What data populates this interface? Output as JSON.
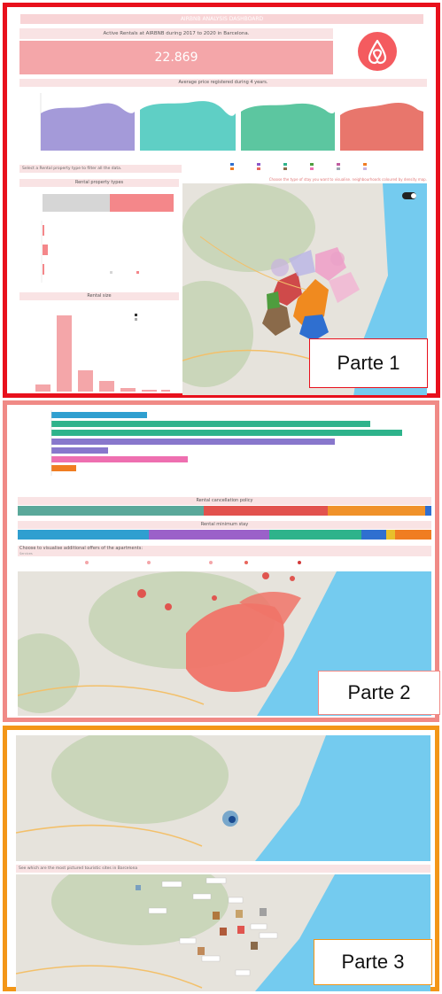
{
  "dashboard": {
    "title": "AIRBNB ANALYSIS DASHBOARD",
    "kpi_label": "Active Rentals at AIRBNB during 2017 to 2020 in Barcelona.",
    "kpi_value": "22.869",
    "avg_price_title": "Average price registered during 4 years.",
    "filter_hint": "Select a Rental property type to filter all the data.",
    "rental_types_title": "Rental property types",
    "rental_size_title": "Rental size",
    "map_hint": "Choose the type of stay you want to visualise. neighbourhoods coloured by density map.",
    "part_labels": [
      "Parte 1",
      "Parte 2",
      "Parte 3"
    ]
  },
  "part2": {
    "cancellation_title": "Rental cancellation policy",
    "min_stay_title": "Rental minimum stay",
    "offers_hint": "Choose to visualise additional offers of the apartments:",
    "offers_sub": "Services"
  },
  "part3": {
    "sights_hint": "See which are the most pictured touristic sites in Barcelona"
  },
  "colors": {
    "part1_border": "#e8101c",
    "part2_border": "#f08a86",
    "part3_border": "#f39617",
    "airbnb": "#f45b5f",
    "purple": "#8877cc",
    "teal": "#3fc1b6",
    "green": "#2eb38b",
    "red": "#e8655c",
    "blue": "#2f9fd0",
    "pink": "#ee6fb0",
    "orange": "#f07d22",
    "sea": "#74cbef"
  }
}
